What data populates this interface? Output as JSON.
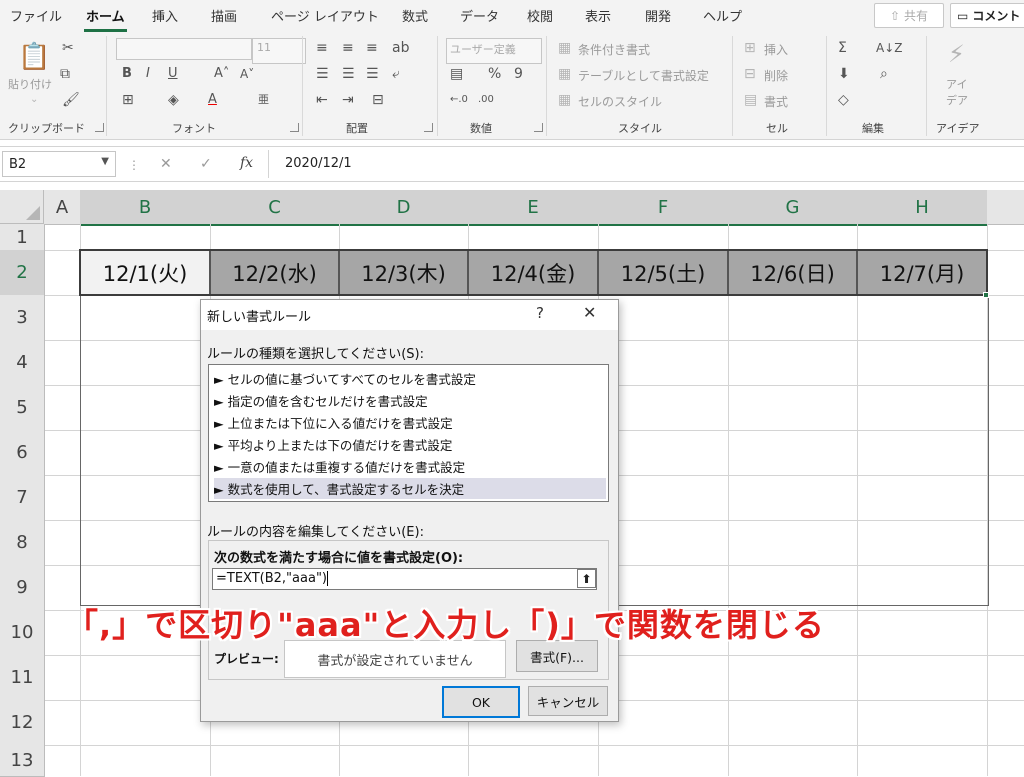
{
  "ribbon": {
    "tabs": [
      "ファイル",
      "ホーム",
      "挿入",
      "描画",
      "ページ レイアウト",
      "数式",
      "データ",
      "校閲",
      "表示",
      "開発",
      "ヘルプ"
    ],
    "active_tab": "ホーム",
    "share_label": "共有",
    "comment_label": "コメント",
    "clipboard": {
      "paste_label": "貼り付け",
      "group_label": "クリップボード"
    },
    "font": {
      "font_size": "11",
      "group_label": "フォント"
    },
    "alignment": {
      "group_label": "配置"
    },
    "number": {
      "format_value": "ユーザー定義",
      "group_label": "数値"
    },
    "styles": {
      "conditional_format": "条件付き書式",
      "format_as_table": "テーブルとして書式設定",
      "cell_styles": "セルのスタイル",
      "group_label": "スタイル"
    },
    "cells": {
      "insert": "挿入",
      "delete": "削除",
      "format": "書式",
      "group_label": "セル"
    },
    "editing": {
      "group_label": "編集"
    },
    "ideas": {
      "label_line1": "アイ",
      "label_line2": "デア",
      "group_label": "アイデア"
    }
  },
  "formula_bar": {
    "cell_ref": "B2",
    "fx_label": "fx",
    "value": "2020/12/1"
  },
  "sheet": {
    "columns": [
      "A",
      "B",
      "C",
      "D",
      "E",
      "F",
      "G",
      "H"
    ],
    "rows": [
      "1",
      "2",
      "3",
      "4",
      "5",
      "6",
      "7",
      "8",
      "9",
      "10",
      "11",
      "12",
      "13"
    ],
    "row2_cells": [
      "12/1(火)",
      "12/2(水)",
      "12/3(木)",
      "12/4(金)",
      "12/5(土)",
      "12/6(日)",
      "12/7(月)"
    ]
  },
  "dialog": {
    "title": "新しい書式ルール",
    "help_glyph": "?",
    "close_glyph": "✕",
    "rule_type_label": "ルールの種類を選択してください(S):",
    "rule_types": [
      "► セルの値に基づいてすべてのセルを書式設定",
      "► 指定の値を含むセルだけを書式設定",
      "► 上位または下位に入る値だけを書式設定",
      "► 平均より上または下の値だけを書式設定",
      "► 一意の値または重複する値だけを書式設定",
      "► 数式を使用して、書式設定するセルを決定"
    ],
    "edit_label": "ルールの内容を編集してください(E):",
    "formula_label": "次の数式を満たす場合に値を書式設定(O):",
    "formula_value": "=TEXT(B2,\"aaa\")",
    "preview_label": "プレビュー:",
    "preview_text": "書式が設定されていません",
    "format_button": "書式(F)...",
    "ok_button": "OK",
    "cancel_button": "キャンセル"
  },
  "annotation": "「,」で区切り\"aaa\"と入力し「)」で関数を閉じる",
  "colors": {
    "accent_green": "#217346",
    "annotation_red": "#e0201d",
    "selected_header_fill": "#a6a6a6"
  }
}
